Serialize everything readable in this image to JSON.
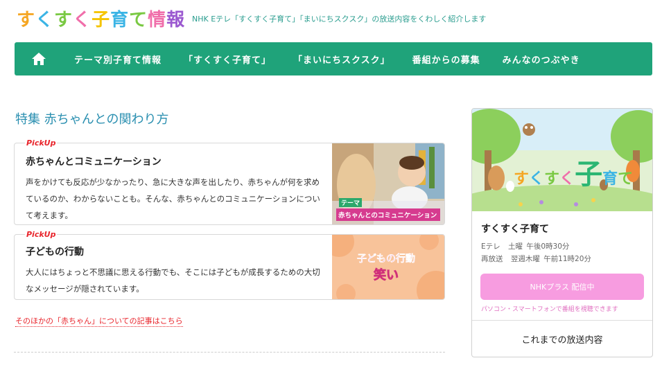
{
  "header": {
    "logo_chars": [
      {
        "char": "す",
        "color": "#f5a623"
      },
      {
        "char": "く",
        "color": "#3bb4e5"
      },
      {
        "char": "す",
        "color": "#7ac943"
      },
      {
        "char": "く",
        "color": "#f06eaa"
      },
      {
        "char": "子",
        "color": "#f5c400"
      },
      {
        "char": "育",
        "color": "#3bb4e5"
      },
      {
        "char": "て",
        "color": "#7ac943"
      },
      {
        "char": "情",
        "color": "#f06eaa"
      },
      {
        "char": "報",
        "color": "#9b59d0"
      }
    ],
    "tagline": "NHK Eテレ「すくすく子育て」「まいにちスクスク」の放送内容をくわしく紹介します"
  },
  "nav": {
    "home_icon": "home-icon",
    "items": [
      "テーマ別子育て情報",
      "「すくすく子育て」",
      "「まいにちスクスク」",
      "番組からの募集",
      "みんなのつぶやき"
    ]
  },
  "main": {
    "section_title": "特集 赤ちゃんとの関わり方",
    "cards": [
      {
        "badge": "PickUp",
        "title": "赤ちゃんとコミュニケーション",
        "text": "声をかけても反応が少なかったり、急に大きな声を出したり、赤ちゃんが何を求めているのか、わからないことも。そんな、赤ちゃんとのコミュニケーションについて考えます。",
        "thumb_label_top": "テーマ",
        "thumb_label": "赤ちゃんとのコミュニケーション"
      },
      {
        "badge": "PickUp",
        "title": "子どもの行動",
        "text": "大人にはちょっと不思議に思える行動でも、そこには子どもが成長するための大切なメッセージが隠されています。",
        "thumb_label": "子どもの行動",
        "thumb_label2": "笑い"
      }
    ],
    "more_link": "そのほかの「赤ちゃん」についての記事はこちら"
  },
  "sidebar": {
    "banner_logo": [
      "す",
      "く",
      "す",
      "く",
      "子",
      "育",
      "て"
    ],
    "title": "すくすく子育て",
    "schedule": [
      {
        "label": "Eテレ",
        "day": "土曜",
        "time": "午後0時30分"
      },
      {
        "label": "再放送",
        "day": "翌週木曜",
        "time": "午前11時20分"
      }
    ],
    "plus_button": "NHKプラス 配信中",
    "plus_note": "パソコン・スマートフォンで番組を視聴できます",
    "past_link": "これまでの放送内容"
  },
  "colors": {
    "nav_bg": "#1fa37a",
    "accent_blue": "#2a8fb0",
    "pickup_red": "#e8242b",
    "plus_pink": "#f79ce0"
  }
}
